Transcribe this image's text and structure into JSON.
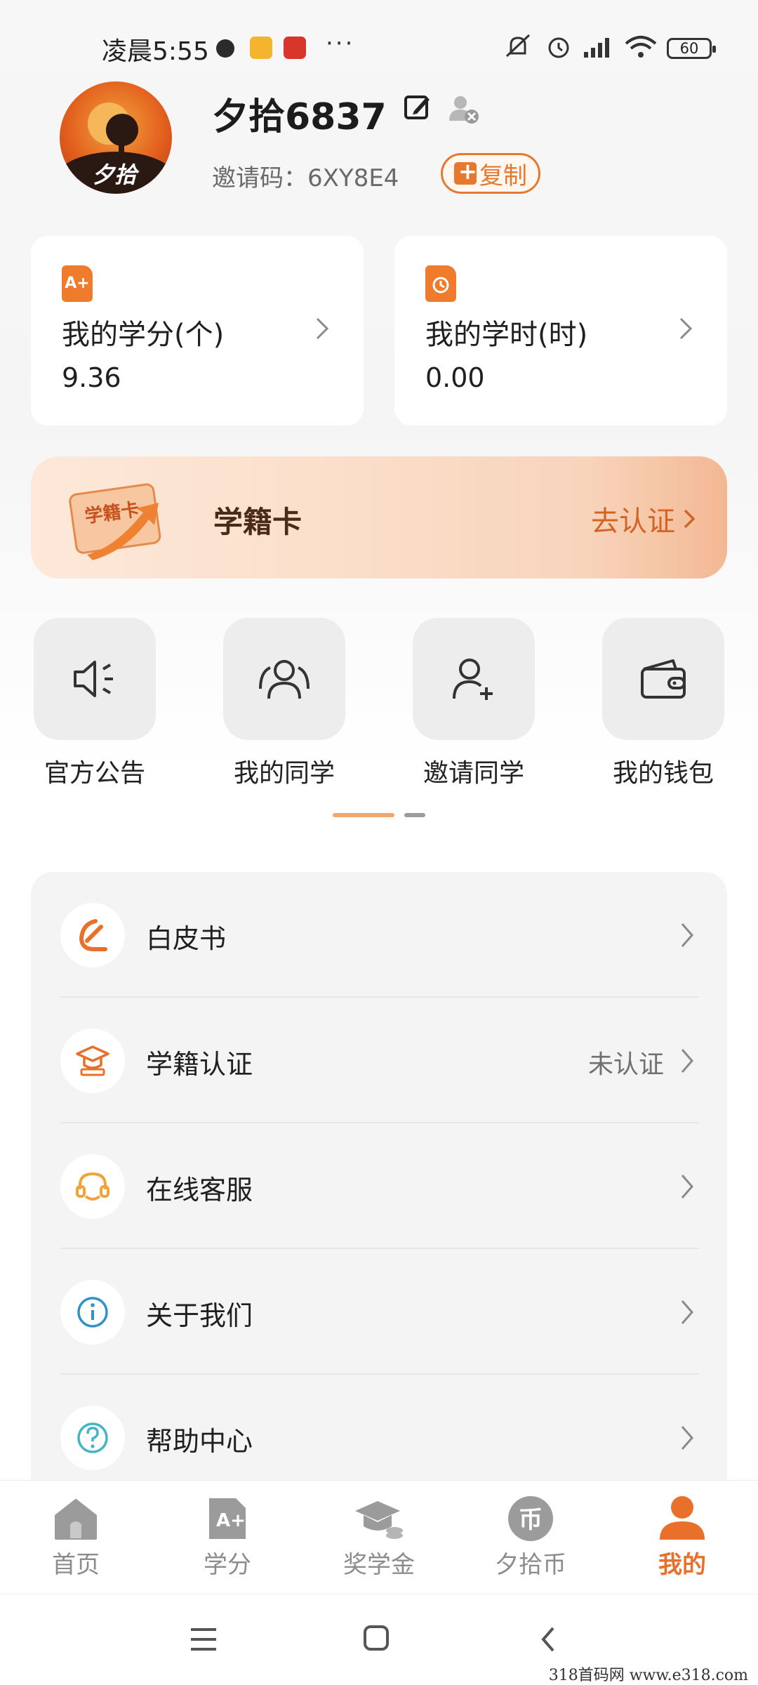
{
  "status_bar": {
    "time": "凌晨5:55",
    "more": "···",
    "battery": "60"
  },
  "profile": {
    "username": "夕拾6837",
    "avatar_text": "夕拾",
    "invite_label": "邀请码：6XY8E4",
    "copy_label": "复制"
  },
  "stats": [
    {
      "label": "我的学分(个)",
      "value": "9.36",
      "icon_text": "A+"
    },
    {
      "label": "我的学时(时)",
      "value": "0.00"
    }
  ],
  "banner": {
    "card_text": "学籍卡",
    "title": "学籍卡",
    "cta": "去认证"
  },
  "quick_actions": [
    {
      "label": "官方公告",
      "icon": "speaker-icon"
    },
    {
      "label": "我的同学",
      "icon": "classmates-icon"
    },
    {
      "label": "邀请同学",
      "icon": "add-user-icon"
    },
    {
      "label": "我的钱包",
      "icon": "wallet-icon"
    }
  ],
  "menu": [
    {
      "label": "白皮书",
      "status": "",
      "icon": "whitepaper-icon"
    },
    {
      "label": "学籍认证",
      "status": "未认证",
      "icon": "graduate-icon"
    },
    {
      "label": "在线客服",
      "status": "",
      "icon": "headset-icon"
    },
    {
      "label": "关于我们",
      "status": "",
      "icon": "info-icon"
    },
    {
      "label": "帮助中心",
      "status": "",
      "icon": "help-icon"
    }
  ],
  "bottom_nav": [
    {
      "label": "首页",
      "icon": "home-icon",
      "active": false
    },
    {
      "label": "学分",
      "icon": "credit-icon",
      "active": false,
      "icon_text": "A+"
    },
    {
      "label": "奖学金",
      "icon": "scholarship-icon",
      "active": false
    },
    {
      "label": "夕拾币",
      "icon": "coin-icon",
      "active": false,
      "icon_text": "币"
    },
    {
      "label": "我的",
      "icon": "profile-icon",
      "active": true
    }
  ],
  "watermark": "318首码网  www.e318.com",
  "colors": {
    "accent": "#e8702a",
    "muted": "#8c8c8c",
    "card_bg": "#ffffff",
    "list_bg": "#f4f4f4"
  }
}
